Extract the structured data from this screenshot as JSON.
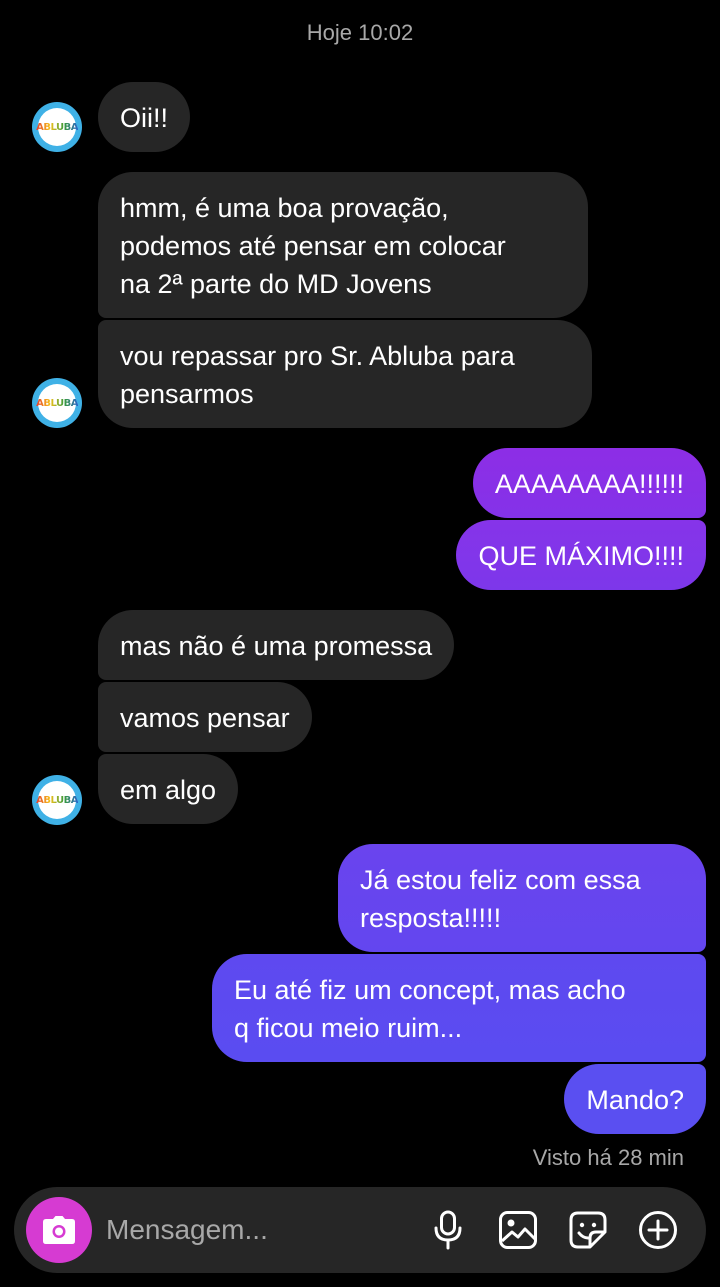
{
  "header": {
    "timestamp": "Hoje 10:02"
  },
  "messages": [
    {
      "side": "in",
      "text": "Oii!!"
    },
    {
      "side": "in",
      "text": "hmm, é uma boa provação,\npodemos até pensar em colocar\nna 2ª parte do MD Jovens"
    },
    {
      "side": "in",
      "text": "vou repassar pro Sr. Abluba para\npensarmos"
    },
    {
      "side": "out",
      "text": "AAAAAAAA!!!!!!"
    },
    {
      "side": "out",
      "text": "QUE MÁXIMO!!!!"
    },
    {
      "side": "in",
      "text": "mas não é uma promessa"
    },
    {
      "side": "in",
      "text": "vamos pensar"
    },
    {
      "side": "in",
      "text": "em algo"
    },
    {
      "side": "out",
      "text": "Já estou feliz com essa\nresposta!!!!!"
    },
    {
      "side": "out",
      "text": "Eu até fiz um concept, mas acho\nq ficou meio ruim..."
    },
    {
      "side": "out",
      "text": "Mando?"
    }
  ],
  "avatar": {
    "logo_text": "ABLUBA",
    "icon": "abluba-logo-avatar"
  },
  "status": {
    "seen": "Visto há 28 min"
  },
  "composer": {
    "placeholder": "Mensagem...",
    "camera_icon": "camera-icon",
    "tools": [
      "microphone-icon",
      "gallery-icon",
      "sticker-icon",
      "plus-circle-icon"
    ]
  },
  "colors": {
    "background": "#000000",
    "incoming_bubble": "#262626",
    "outgoing_gradient_top": "#8a2be2",
    "outgoing_gradient_bottom": "#5a4ff0",
    "camera_button": "#d63bd2",
    "muted_text": "#a8a8a8"
  }
}
